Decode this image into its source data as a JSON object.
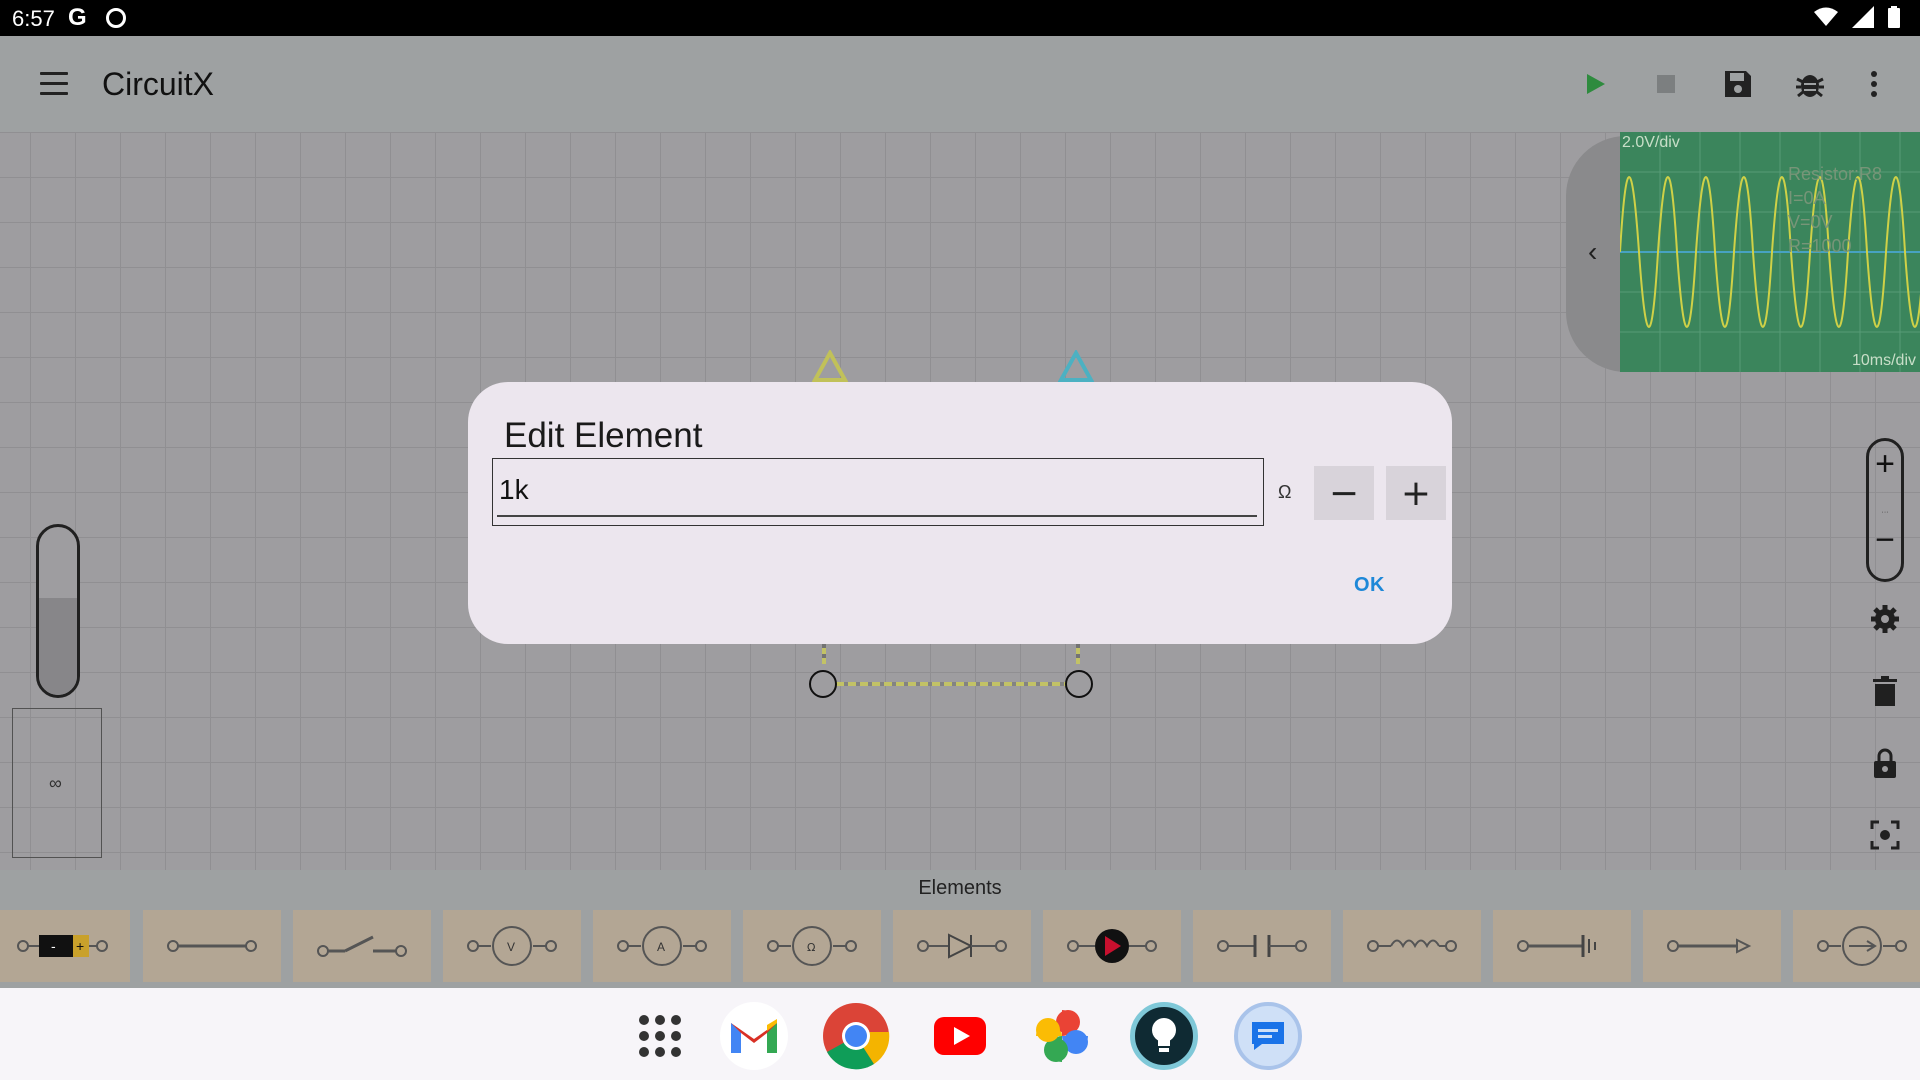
{
  "status": {
    "time": "6:57",
    "g_label": "G"
  },
  "app": {
    "title": "CircuitX"
  },
  "toolbar": {
    "icons": [
      "play-icon",
      "stop-icon",
      "save-icon",
      "debug-icon",
      "more-icon"
    ]
  },
  "scope": {
    "volt_div": "2.0V/div",
    "time_div": "10ms/div",
    "info": [
      "Resistor:R8",
      "I=0A",
      "V=0V",
      "R=1000"
    ],
    "trace_color": "#d6d84a"
  },
  "dialog": {
    "title": "Edit Element",
    "value": "1k",
    "unit": "Ω",
    "minus_label": "−",
    "plus_label": "+",
    "ok_label": "OK"
  },
  "elements": {
    "label": "Elements",
    "items": [
      "battery",
      "wire",
      "switch",
      "voltmeter",
      "ammeter",
      "ohmmeter",
      "diode",
      "led",
      "capacitor",
      "inductor",
      "ground",
      "probe",
      "source"
    ]
  },
  "dock": {
    "apps": [
      "app-drawer",
      "gmail",
      "chrome",
      "youtube",
      "photos",
      "keep",
      "messages"
    ]
  },
  "colors": {
    "accent": "#1e88d8",
    "appbar": "#9ea1a2",
    "play": "#2e8b3e"
  }
}
